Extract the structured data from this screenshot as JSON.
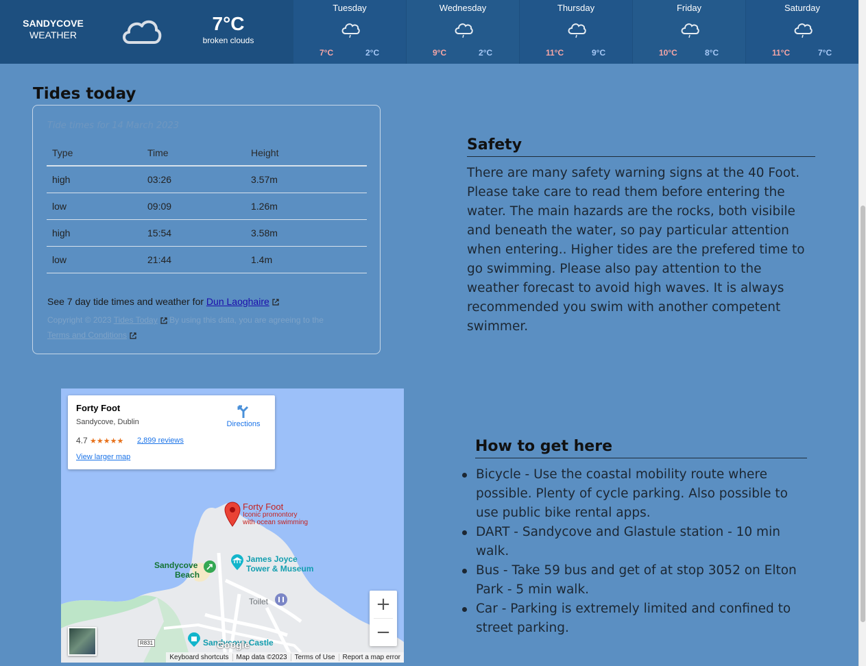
{
  "header": {
    "brand_line1": "SANDYCOVE",
    "brand_line2": "WEATHER",
    "current_icon": "cloud-icon",
    "current_temp": "7°C",
    "current_desc": "broken clouds",
    "forecast": [
      {
        "day": "Tuesday",
        "high": "7°C",
        "low": "2°C",
        "icon": "cloud-rain-icon"
      },
      {
        "day": "Wednesday",
        "high": "9°C",
        "low": "2°C",
        "icon": "cloud-rain-icon"
      },
      {
        "day": "Thursday",
        "high": "11°C",
        "low": "9°C",
        "icon": "cloud-rain-icon"
      },
      {
        "day": "Friday",
        "high": "10°C",
        "low": "8°C",
        "icon": "cloud-rain-icon"
      },
      {
        "day": "Saturday",
        "high": "11°C",
        "low": "7°C",
        "icon": "cloud-rain-icon"
      }
    ]
  },
  "tides": {
    "title": "Tides today",
    "caption": "Tide times for 14 March 2023",
    "columns": [
      "Type",
      "Time",
      "Height"
    ],
    "rows": [
      [
        "high",
        "03:26",
        "3.57m"
      ],
      [
        "low",
        "09:09",
        "1.26m"
      ],
      [
        "high",
        "15:54",
        "3.58m"
      ],
      [
        "low",
        "21:44",
        "1.4m"
      ]
    ],
    "more_text": "See 7 day tide times and weather for ",
    "more_link": "Dun Laoghaire",
    "copyright_prefix": "Copyright © 2023 ",
    "copyright_link": "Tides Today",
    "copyright_mid": " By using this data, you are agreeing to the ",
    "terms_link": "Terms and Conditions"
  },
  "safety": {
    "title": "Safety",
    "text": "There are many safety warning signs at the 40 Foot. Please take care to read them before entering the water. The main hazards are the rocks, both visibile and beneath the water, so pay particular attention when entering.. Higher tides are the prefered time to go swimming. Please also pay attention to the weather forecast to avoid high waves. It is always recommended you swim with another competent swimmer."
  },
  "directions": {
    "title": "How to get here",
    "items": [
      "Bicycle - Use the coastal mobility route where possible. Plenty of cycle parking. Also possible to use public bike rental apps.",
      "DART - Sandycove and Glastule station - 10 min walk.",
      "Bus - Take 59 bus and get of at stop 3052 on Elton Park - 5 min walk.",
      "Car - Parking is extremely limited and confined to street parking."
    ]
  },
  "map": {
    "place_name": "Forty Foot",
    "place_address": "Sandycove, Dublin",
    "rating": "4.7",
    "stars": "★★★★★",
    "reviews": "2,899 reviews",
    "view_larger": "View larger map",
    "directions_label": "Directions",
    "pin_title": "Forty Foot",
    "pin_sub1": "Iconic promontory",
    "pin_sub2": "with ocean swimming",
    "label_beach1": "Sandycove",
    "label_beach2": "Beach",
    "label_museum1": "James Joyce",
    "label_museum2": "Tower & Museum",
    "label_toilet": "Toilet",
    "label_castle": "Sandycove Castle",
    "road": "R831",
    "google": "Google",
    "zoom_in": "+",
    "zoom_out": "−",
    "footer": [
      "Keyboard shortcuts",
      "Map data ©2023",
      "Terms of Use",
      "Report a map error"
    ]
  }
}
